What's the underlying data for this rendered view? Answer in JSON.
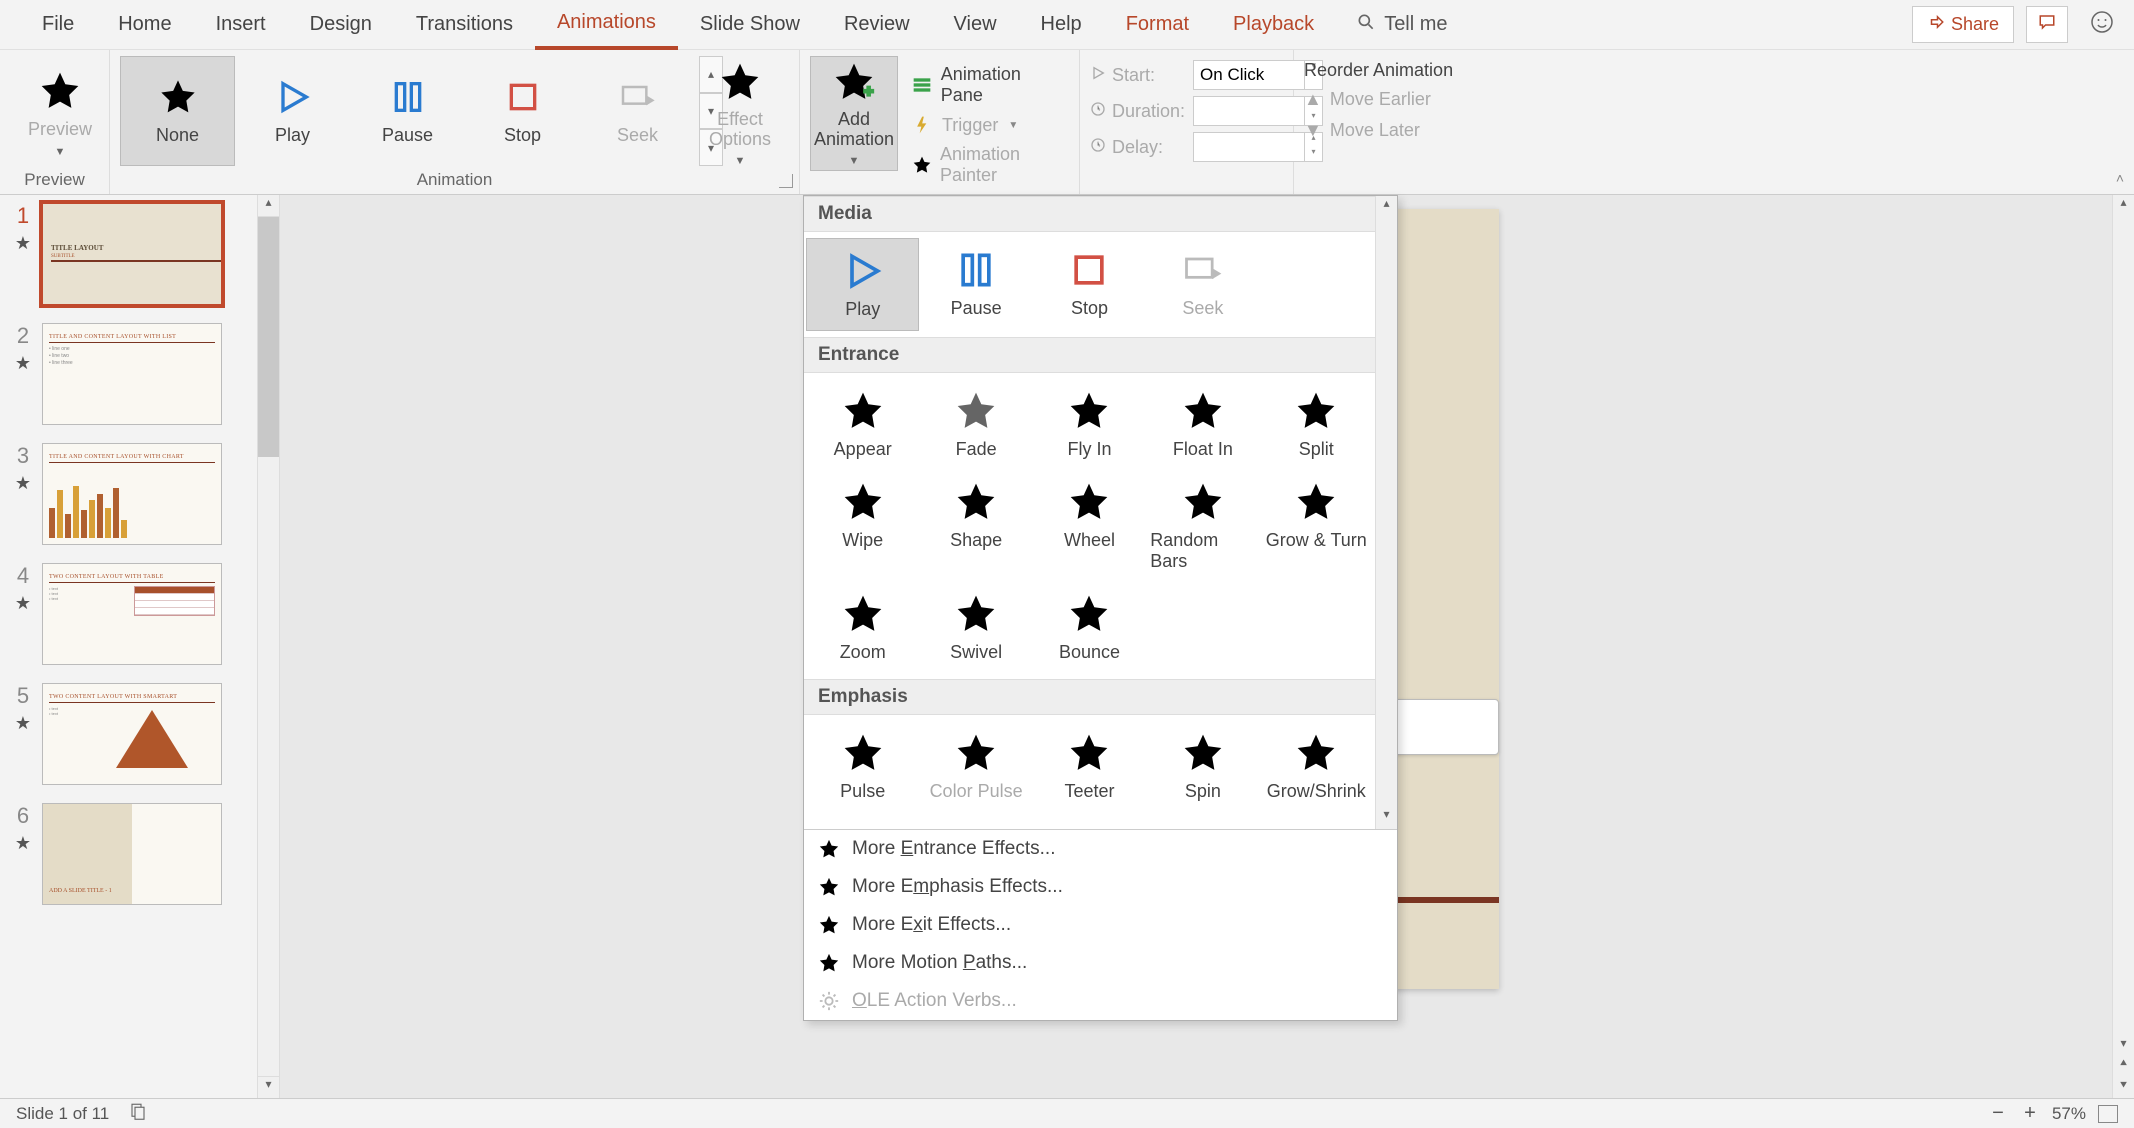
{
  "menu": {
    "tabs": [
      "File",
      "Home",
      "Insert",
      "Design",
      "Transitions",
      "Animations",
      "Slide Show",
      "Review",
      "View",
      "Help",
      "Format",
      "Playback"
    ],
    "active": "Animations",
    "tell_me": "Tell me",
    "share": "Share"
  },
  "ribbon": {
    "preview": {
      "label": "Preview",
      "group": "Preview"
    },
    "animation_group": "Animation",
    "gallery": {
      "items": [
        {
          "label": "None",
          "selected": true,
          "icon": "gray"
        },
        {
          "label": "Play",
          "icon": "play"
        },
        {
          "label": "Pause",
          "icon": "pause"
        },
        {
          "label": "Stop",
          "icon": "stop"
        },
        {
          "label": "Seek",
          "icon": "seek"
        }
      ]
    },
    "effect_options": "Effect Options",
    "add_animation": "Add Animation",
    "adv": {
      "pane": "Animation Pane",
      "trigger": "Trigger",
      "painter": "Animation Painter"
    },
    "timing": {
      "start_label": "Start:",
      "start_value": "On Click",
      "duration_label": "Duration:",
      "duration_value": "",
      "delay_label": "Delay:",
      "delay_value": ""
    },
    "reorder": {
      "title": "Reorder Animation",
      "earlier": "Move Earlier",
      "later": "Move Later"
    }
  },
  "thumbs": {
    "items": [
      {
        "num": "1",
        "title": "TITLE LAYOUT",
        "subtitle": "SUBTITLE",
        "kind": "title",
        "active": true
      },
      {
        "num": "2",
        "title": "TITLE AND CONTENT LAYOUT WITH LIST",
        "kind": "list"
      },
      {
        "num": "3",
        "title": "TITLE AND CONTENT LAYOUT WITH CHART",
        "kind": "chart"
      },
      {
        "num": "4",
        "title": "TWO CONTENT LAYOUT WITH TABLE",
        "kind": "table"
      },
      {
        "num": "5",
        "title": "TWO CONTENT LAYOUT WITH SMARTART",
        "kind": "triangle"
      },
      {
        "num": "6",
        "title": "ADD A SLIDE TITLE - 1",
        "kind": "split"
      }
    ]
  },
  "slide": {
    "title": "TITLE LAYOUT",
    "subtitle": "SUBTITLE"
  },
  "dropdown": {
    "sections": {
      "media": {
        "header": "Media",
        "items": [
          {
            "label": "Play",
            "icon": "play",
            "sel": true
          },
          {
            "label": "Pause",
            "icon": "pause"
          },
          {
            "label": "Stop",
            "icon": "stop"
          },
          {
            "label": "Seek",
            "icon": "seek",
            "disabled": true
          }
        ]
      },
      "entrance": {
        "header": "Entrance",
        "items": [
          {
            "label": "Appear"
          },
          {
            "label": "Fade"
          },
          {
            "label": "Fly In"
          },
          {
            "label": "Float In"
          },
          {
            "label": "Split"
          },
          {
            "label": "Wipe"
          },
          {
            "label": "Shape"
          },
          {
            "label": "Wheel"
          },
          {
            "label": "Random Bars"
          },
          {
            "label": "Grow & Turn"
          },
          {
            "label": "Zoom"
          },
          {
            "label": "Swivel"
          },
          {
            "label": "Bounce"
          }
        ]
      },
      "emphasis": {
        "header": "Emphasis",
        "items": [
          {
            "label": "Pulse"
          },
          {
            "label": "Color Pulse",
            "disabled": true
          },
          {
            "label": "Teeter"
          },
          {
            "label": "Spin"
          },
          {
            "label": "Grow/Shrink"
          }
        ]
      }
    },
    "footer": {
      "entrance": "More Entrance Effects...",
      "emphasis": "More Emphasis Effects...",
      "exit": "More Exit Effects...",
      "motion": "More Motion Paths...",
      "ole": "OLE Action Verbs..."
    }
  },
  "status": {
    "slide": "Slide 1 of 11",
    "zoom": "57%"
  }
}
